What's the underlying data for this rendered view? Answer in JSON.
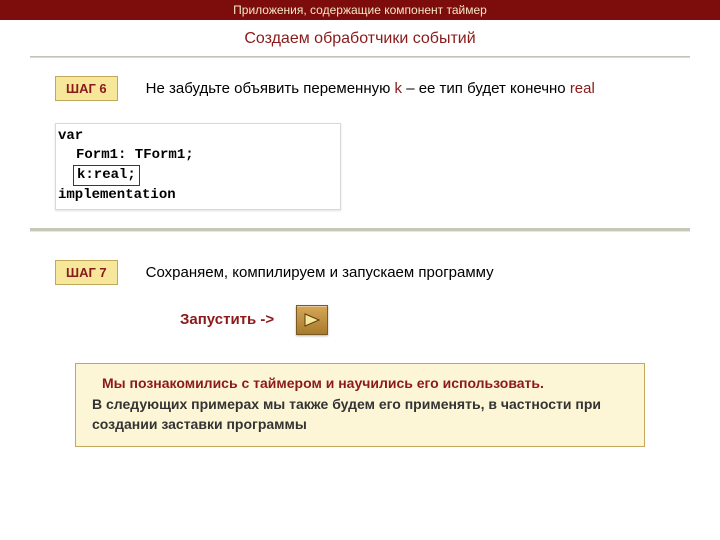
{
  "header": {
    "title": "Приложения, содержащие компонент таймер"
  },
  "subtitle": "Создаем обработчики событий",
  "step6": {
    "badge": "ШАГ 6",
    "text_pre": "Не забудьте объявить переменную ",
    "text_var": "k",
    "text_mid": " – ее тип будет конечно ",
    "text_type": "real"
  },
  "code": {
    "line1": "var",
    "line2": "Form1: TForm1;",
    "line3": "k:real;",
    "line4": "implementation"
  },
  "step7": {
    "badge": "ШАГ 7",
    "text": "Сохраняем, компилируем и запускаем программу"
  },
  "launch": {
    "label": "Запустить ->"
  },
  "summary": {
    "line1": "Мы познакомились с таймером и научились его использовать.",
    "line2": "В следующих примерах мы также будем его применять, в частности при создании заставки программы"
  }
}
